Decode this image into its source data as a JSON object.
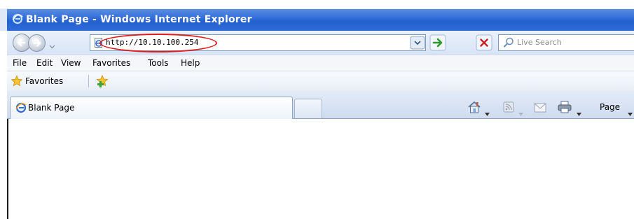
{
  "window": {
    "title": "Blank Page - Windows Internet Explorer"
  },
  "address_bar": {
    "url": "http://10.10.100.254"
  },
  "search": {
    "placeholder": "Live Search"
  },
  "menu": [
    {
      "label": "File"
    },
    {
      "label": "Edit"
    },
    {
      "label": "View"
    },
    {
      "label": "Favorites"
    },
    {
      "label": "Tools"
    },
    {
      "label": "Help"
    }
  ],
  "favorites_bar": {
    "label": "Favorites"
  },
  "tabs": [
    {
      "label": "Blank Page",
      "active": true
    }
  ],
  "toolbar": {
    "page_label": "Page"
  },
  "icons": {
    "title": "ie-icon",
    "back": "back-arrow-icon",
    "forward": "forward-arrow-icon",
    "go": "go-arrow-icon",
    "stop": "stop-x-icon",
    "search": "search-icon",
    "favorites": "star-icon",
    "add_favorite": "add-favorite-icon",
    "home": "home-icon",
    "feeds": "feeds-icon",
    "mail": "mail-icon",
    "print": "print-icon"
  },
  "colors": {
    "title_bar": "#2f6ad8",
    "url_highlight": "#e01b1b",
    "go_arrow": "#2e9a2e",
    "stop": "#c62222"
  }
}
